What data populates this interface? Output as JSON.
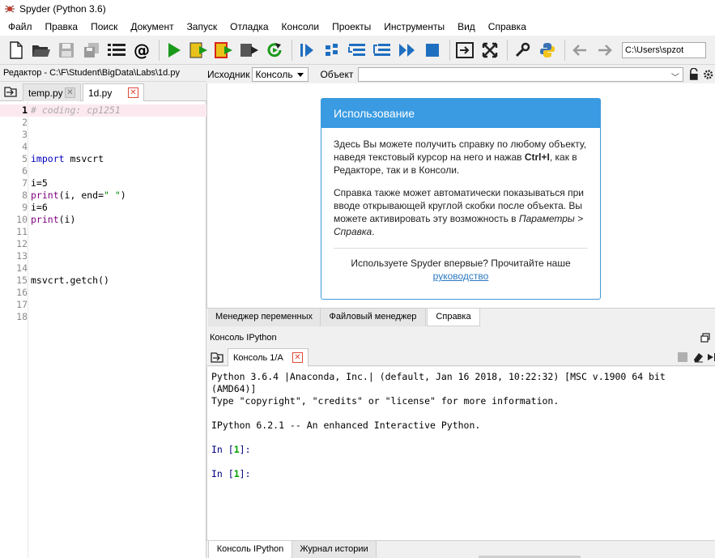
{
  "window": {
    "title": "Spyder (Python 3.6)"
  },
  "menu": {
    "items": [
      "Файл",
      "Правка",
      "Поиск",
      "Документ",
      "Запуск",
      "Отладка",
      "Консоли",
      "Проекты",
      "Инструменты",
      "Вид",
      "Справка"
    ]
  },
  "toolbar": {
    "path_value": "C:\\Users\\spzot",
    "buttons": [
      "new-file-icon",
      "open-file-icon",
      "save-icon",
      "save-all-icon",
      "list-icon",
      "at-icon",
      "run-icon",
      "run-cell-icon",
      "run-cell-advance-icon",
      "run-selection-icon",
      "rerun-icon",
      "debug-icon",
      "step-icon",
      "step-into-icon",
      "step-return-icon",
      "continue-icon",
      "stop-debug-icon",
      "maximize-pane-icon",
      "fullscreen-icon",
      "wrench-icon",
      "python-icon",
      "back-arrow-icon",
      "forward-arrow-icon"
    ],
    "colors": {
      "green": "#1a9a1a",
      "blue": "#1f6fc0",
      "yellow": "#e8c21a",
      "red": "#d8261b"
    }
  },
  "editor": {
    "header": "Редактор - C:\\F\\Student\\BigData\\Labs\\1d.py",
    "tabs": [
      {
        "label": "temp.py",
        "active": false
      },
      {
        "label": "1d.py",
        "active": true
      }
    ],
    "lines": [
      {
        "num": "1",
        "text": "# coding: cp1251"
      },
      {
        "num": "2",
        "text": ""
      },
      {
        "num": "3",
        "text": ""
      },
      {
        "num": "4",
        "text": ""
      },
      {
        "num": "5",
        "text": "import msvcrt"
      },
      {
        "num": "6",
        "text": ""
      },
      {
        "num": "7",
        "text": "i=5"
      },
      {
        "num": "8",
        "text": "print(i, end=\" \")"
      },
      {
        "num": "9",
        "text": "i=6"
      },
      {
        "num": "10",
        "text": "print(i)"
      },
      {
        "num": "11",
        "text": ""
      },
      {
        "num": "12",
        "text": ""
      },
      {
        "num": "13",
        "text": ""
      },
      {
        "num": "14",
        "text": ""
      },
      {
        "num": "15",
        "text": "msvcrt.getch()"
      },
      {
        "num": "16",
        "text": ""
      },
      {
        "num": "17",
        "text": ""
      },
      {
        "num": "18",
        "text": ""
      }
    ]
  },
  "help": {
    "source_label": "Исходник",
    "source_value": "Консоль",
    "object_label": "Объект",
    "object_value": "",
    "card_title": "Использование",
    "para1_a": "Здесь Вы можете получить справку по любому объекту, наведя текстовый курсор на него и нажав ",
    "para1_key": "Ctrl+I",
    "para1_b": ", как в Редакторе, так и в Консоли.",
    "para2_a": "Справка также может автоматически показываться при вводе открывающей круглой скобки после объекта. Вы можете активировать эту возможность в ",
    "para2_em": "Параметры > Справка",
    "para2_b": ".",
    "footer_text": "Используете Spyder впервые? Прочитайте наше",
    "footer_link": "руководство",
    "accent_color": "#3a9be2"
  },
  "pane_tabs": [
    "Менеджер переменных",
    "Файловый менеджер",
    "Справка"
  ],
  "console": {
    "header": "Консоль IPython",
    "tab_label": "Консоль 1/A",
    "lines": {
      "l1": "Python 3.6.4 |Anaconda, Inc.| (default, Jan 16 2018, 10:22:32) [MSC v.1900 64 bit",
      "l2": "(AMD64)]",
      "l3": "Type \"copyright\", \"credits\" or \"license\" for more information.",
      "l4": "IPython 6.2.1 -- An enhanced Interactive Python."
    },
    "prompt1": "In [1]:",
    "prompt2": "In [1]:"
  },
  "bottom_tabs": [
    "Консоль IPython",
    "Журнал истории"
  ]
}
